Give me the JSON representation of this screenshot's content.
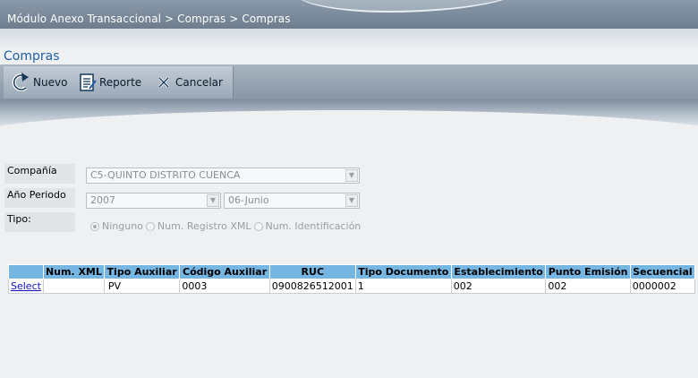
{
  "header": {
    "breadcrumb": "Módulo Anexo Transaccional > Compras > Compras"
  },
  "page": {
    "title": "Compras"
  },
  "toolbar": {
    "nuevo_label": "Nuevo",
    "reporte_label": "Reporte",
    "cancelar_label": "Cancelar",
    "nuevo_icon": "refresh-arrow-icon",
    "reporte_icon": "report-icon",
    "cancelar_icon": "x-icon"
  },
  "form": {
    "compania_label": "Compañía",
    "compania_value": "C5-QUINTO DISTRITO CUENCA",
    "anio_periodo_label": "Año Periodo",
    "anio_value": "2007",
    "periodo_value": "06-Junio",
    "tipo_label": "Tipo:",
    "tipo_options": [
      "Ninguno",
      "Num. Registro XML",
      "Num. Identificación"
    ],
    "tipo_selected": "Ninguno"
  },
  "table": {
    "headers": [
      "",
      "Num. XML",
      "Tipo Auxiliar",
      "Código Auxiliar",
      "RUC",
      "Tipo Documento",
      "Establecimiento",
      "Punto Emisión",
      "Secuencial"
    ],
    "rows": [
      {
        "action": "Select",
        "num_xml": "",
        "tipo_auxiliar": "PV",
        "codigo_auxiliar": "0003",
        "ruc": "0900826512001",
        "tipo_documento": "1",
        "establecimiento": "002",
        "punto_emision": "002",
        "secuencial": "0000002"
      }
    ]
  },
  "colors": {
    "accent": "#1f5fa8",
    "grid_header": "#75b6e3",
    "link": "#1010c0"
  }
}
